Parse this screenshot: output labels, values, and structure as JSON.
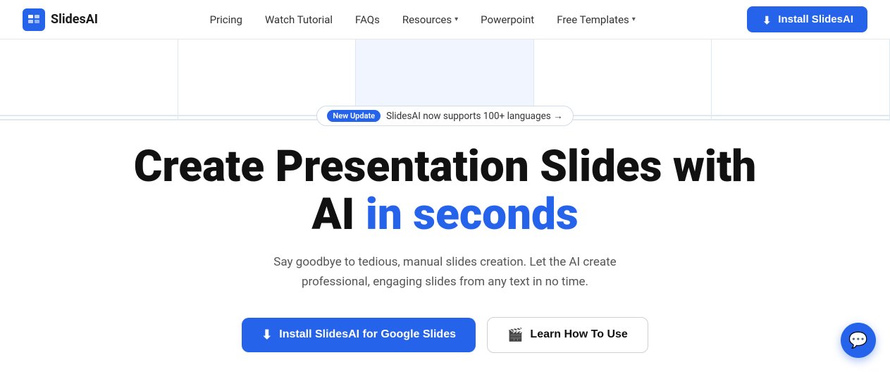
{
  "navbar": {
    "logo_text": "SlidesAI",
    "nav_items": [
      {
        "label": "Pricing",
        "has_dropdown": false
      },
      {
        "label": "Watch Tutorial",
        "has_dropdown": false
      },
      {
        "label": "FAQs",
        "has_dropdown": false
      },
      {
        "label": "Resources",
        "has_dropdown": true
      },
      {
        "label": "Powerpoint",
        "has_dropdown": false
      },
      {
        "label": "Free Templates",
        "has_dropdown": true
      }
    ],
    "cta_label": "Install SlidesAI"
  },
  "hero": {
    "badge": {
      "label": "New Update",
      "text": "SlidesAI now supports 100+ languages →"
    },
    "title_line1": "Create Presentation Slides with",
    "title_line2_black": "AI",
    "title_line2_blue": "in seconds",
    "subtitle": "Say goodbye to tedious, manual slides creation. Let the AI create professional, engaging slides from any text in no time.",
    "btn_primary": "Install SlidesAI for Google Slides",
    "btn_secondary": "Learn How To Use",
    "btn_primary_icon": "⬇",
    "btn_secondary_icon": "🎬"
  },
  "chat": {
    "icon": "💬"
  },
  "colors": {
    "accent": "#2563eb",
    "text_primary": "#111111",
    "text_muted": "#555555"
  }
}
